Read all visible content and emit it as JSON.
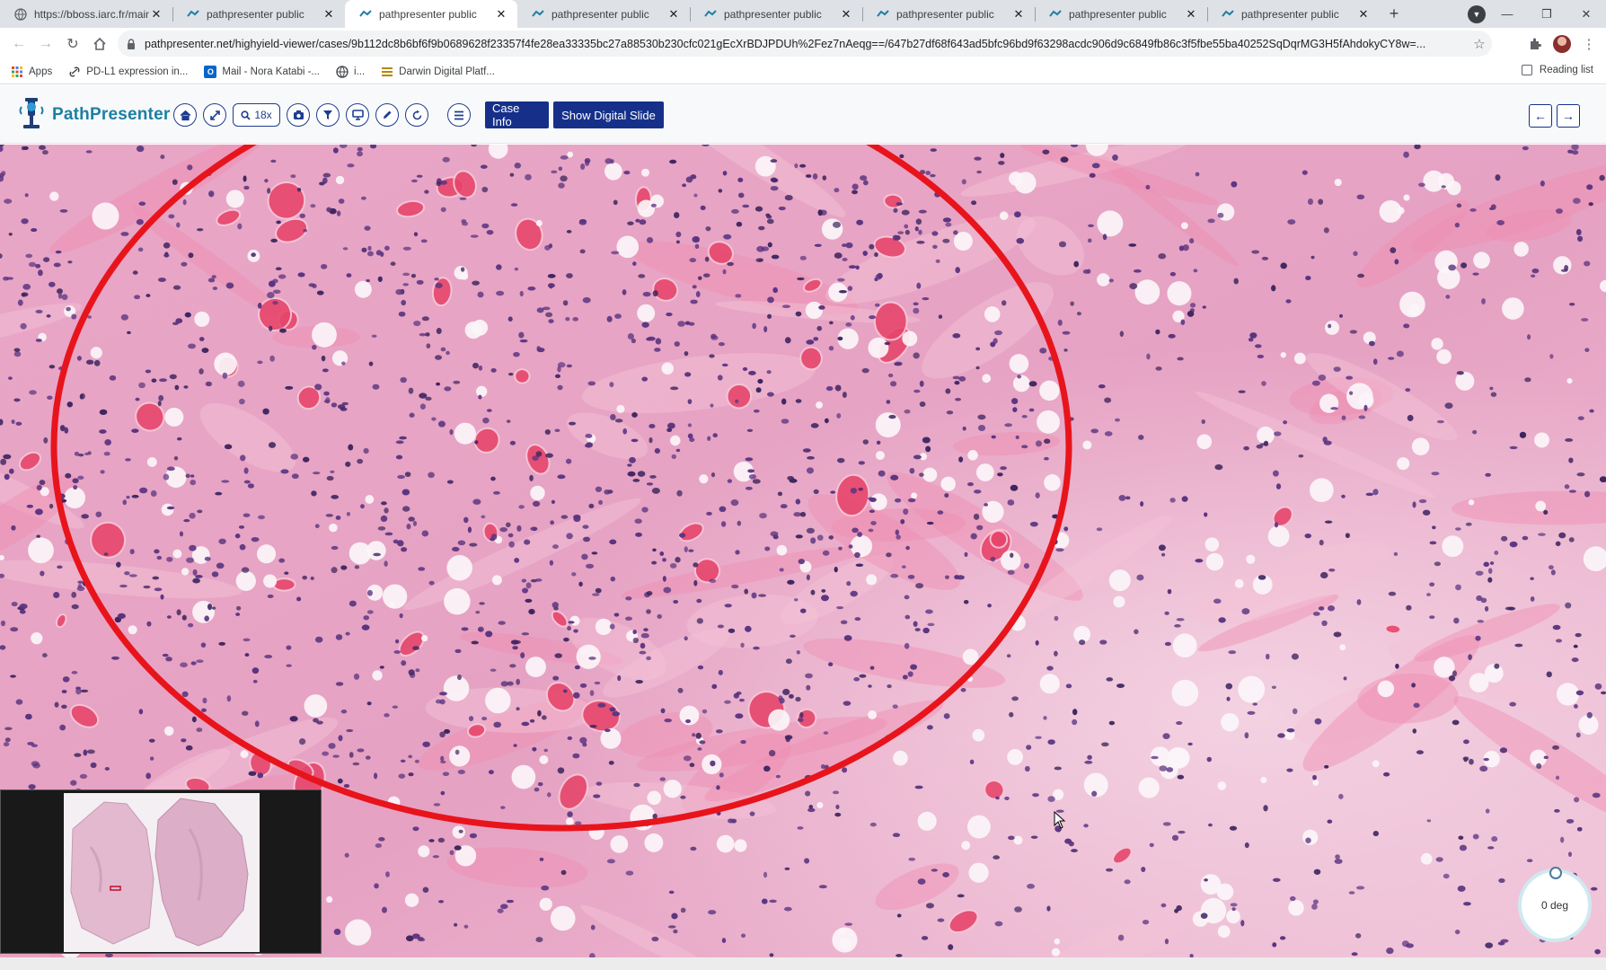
{
  "browser": {
    "tabs": [
      {
        "title": "https://bboss.iarc.fr/main.p",
        "icon": "globe-icon",
        "active": false
      },
      {
        "title": "pathpresenter public",
        "icon": "pathpresenter-favicon",
        "active": false
      },
      {
        "title": "pathpresenter public",
        "icon": "pathpresenter-favicon",
        "active": true
      },
      {
        "title": "pathpresenter public",
        "icon": "pathpresenter-favicon",
        "active": false
      },
      {
        "title": "pathpresenter public",
        "icon": "pathpresenter-favicon",
        "active": false
      },
      {
        "title": "pathpresenter public",
        "icon": "pathpresenter-favicon",
        "active": false
      },
      {
        "title": "pathpresenter public",
        "icon": "pathpresenter-favicon",
        "active": false
      },
      {
        "title": "pathpresenter public",
        "icon": "pathpresenter-favicon",
        "active": false
      }
    ],
    "url": "pathpresenter.net/highyield-viewer/cases/9b112dc8b6bf6f9b0689628f23357f4fe28ea33335bc27a88530b230cfc021gEcXrBDJPDUh%2Fez7nAeqg==/647b27df68f643ad5bfc96bd9f63298acdc906d9c6849fb86c3f5fbe55ba40252SqDqrMG3H5fAhdokyCY8w=...",
    "bookmarks": [
      {
        "label": "Apps",
        "icon": "apps-grid-icon"
      },
      {
        "label": "PD-L1 expression in...",
        "icon": "link-icon"
      },
      {
        "label": "Mail - Nora Katabi -...",
        "icon": "outlook-icon"
      },
      {
        "label": "i...",
        "icon": "globe-icon"
      },
      {
        "label": "Darwin Digital Platf...",
        "icon": "darwin-icon"
      }
    ],
    "reading_list": "Reading list"
  },
  "app": {
    "brand": "PathPresenter",
    "zoom_label": "18x",
    "case_info_label": "Case Info",
    "show_slide_label": "Show Digital Slide",
    "rotation_label": "0 deg",
    "colors": {
      "brand_text": "#1d7fa3",
      "button_bg": "#16308a",
      "annotation": "#e8141c",
      "tissue_pink": "#e7a9c4",
      "nucleus": "#5a3480"
    }
  }
}
